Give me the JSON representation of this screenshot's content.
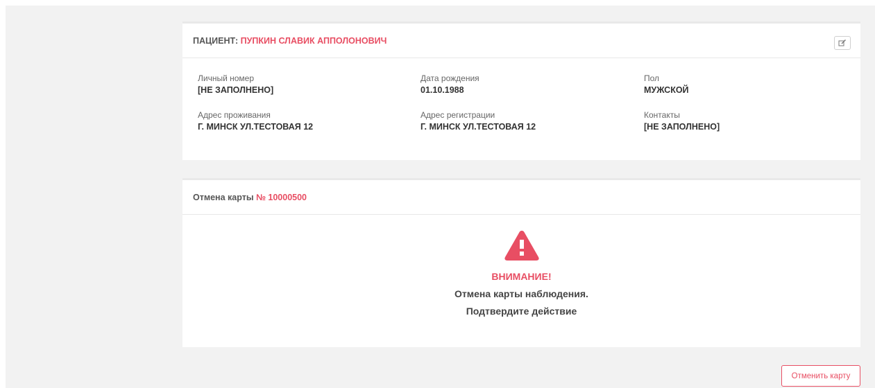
{
  "patient": {
    "label": "ПАЦИЕНТ:",
    "name": "ПУПКИН СЛАВИК АППОЛОНОВИЧ",
    "edit_icon": "edit-icon",
    "fields": {
      "personal_number": {
        "label": "Личный номер",
        "value": "[НЕ ЗАПОЛНЕНО]"
      },
      "birth_date": {
        "label": "Дата рождения",
        "value": "01.10.1988"
      },
      "sex": {
        "label": "Пол",
        "value": "МУЖСКОЙ"
      },
      "residence_address": {
        "label": "Адрес проживания",
        "value": "Г. МИНСК УЛ.ТЕСТОВАЯ 12"
      },
      "registration_address": {
        "label": "Адрес регистрации",
        "value": "Г. МИНСК УЛ.ТЕСТОВАЯ 12"
      },
      "contacts": {
        "label": "Контакты",
        "value": "[НЕ ЗАПОЛНЕНО]"
      }
    }
  },
  "cancellation": {
    "title": "Отмена карты",
    "card_number": "№ 10000500",
    "warning_icon": "warning-triangle-icon",
    "warning_title": "ВНИМАНИЕ!",
    "message_line1": "Отмена карты наблюдения.",
    "message_line2": "Подтвердите действие"
  },
  "actions": {
    "cancel_card_label": "Отменить карту"
  },
  "colors": {
    "accent": "#e84e63",
    "background": "#f2f2f2",
    "panel": "#ffffff"
  }
}
